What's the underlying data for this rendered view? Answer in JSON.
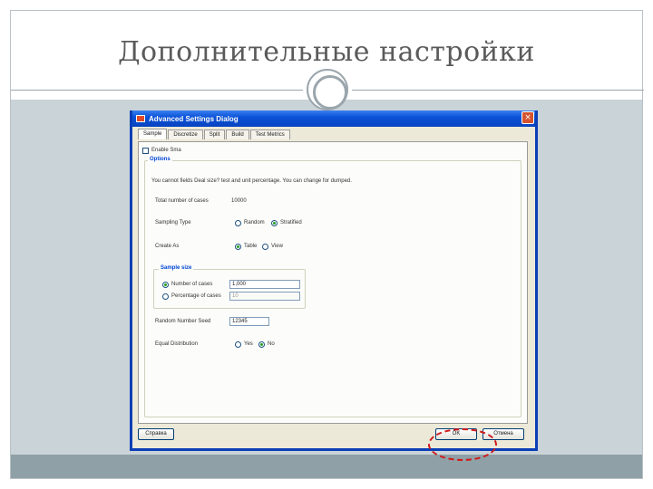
{
  "slide": {
    "title": "Дополнительные настройки"
  },
  "dialog": {
    "title": "Advanced Settings Dialog",
    "close_icon": "×",
    "tabs": [
      {
        "label": "Sample",
        "active": true
      },
      {
        "label": "Discretize",
        "active": false
      },
      {
        "label": "Split",
        "active": false
      },
      {
        "label": "Build",
        "active": false
      },
      {
        "label": "Test Metrics",
        "active": false
      }
    ],
    "enable_label": "Enable Sma",
    "options_header": "Options",
    "description": "You cannot fields Deal size? test and unit percentage. You can change for dumped.",
    "row_count_label": "Total number of cases",
    "row_count_value": "10000",
    "sampling_type_label": "Sampling Type",
    "sampling_random": "Random",
    "sampling_stratified": "Stratified",
    "create_as_label": "Create As",
    "create_table": "Table",
    "create_view": "View",
    "sample_size_header": "Sample size",
    "number_of_cases_label": "Number of cases",
    "number_of_cases_value": "1,000",
    "percentage_label": "Percentage of cases",
    "percentage_value": "10",
    "random_seed_label": "Random Number Seed",
    "random_seed_value": "12345",
    "equal_dist_label": "Equal Distribution",
    "equal_yes": "Yes",
    "equal_no": "No",
    "help_button": "Справка",
    "ok_button": "OK",
    "cancel_button": "Отмена"
  },
  "colors": {
    "titlebar": "#0a53d8",
    "highlight": "#d01818",
    "content_bg": "#c9d3d8"
  }
}
